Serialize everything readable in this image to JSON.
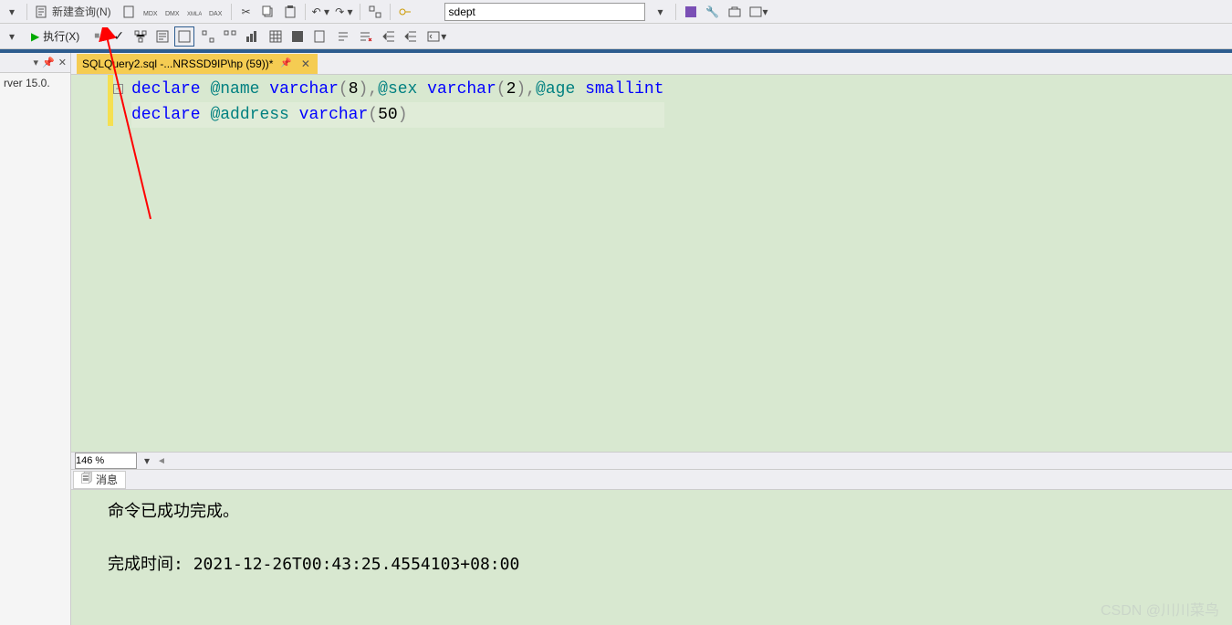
{
  "toolbar1": {
    "new_query": "新建查询(N)",
    "db_selected": "sdept"
  },
  "toolbar2": {
    "execute": "执行(X)"
  },
  "side": {
    "server_text": "rver 15.0."
  },
  "tab": {
    "title": "SQLQuery2.sql -...NRSSD9IP\\hp (59))*"
  },
  "editor": {
    "line1": {
      "declare": "declare",
      "name_var": "@name",
      "varchar": "varchar",
      "name_size": "8",
      "sex_var": "@sex",
      "sex_size": "2",
      "age_var": "@age",
      "smallint": "smallint"
    },
    "line2": {
      "declare": "declare",
      "addr_var": "@address",
      "varchar": "varchar",
      "addr_size": "50"
    }
  },
  "zoom": "146 %",
  "results": {
    "tab_label": "消息",
    "success": "命令已成功完成。",
    "done_label": "完成时间: ",
    "done_time": "2021-12-26T00:43:25.4554103+08:00"
  },
  "watermark": "CSDN @川川菜鸟"
}
